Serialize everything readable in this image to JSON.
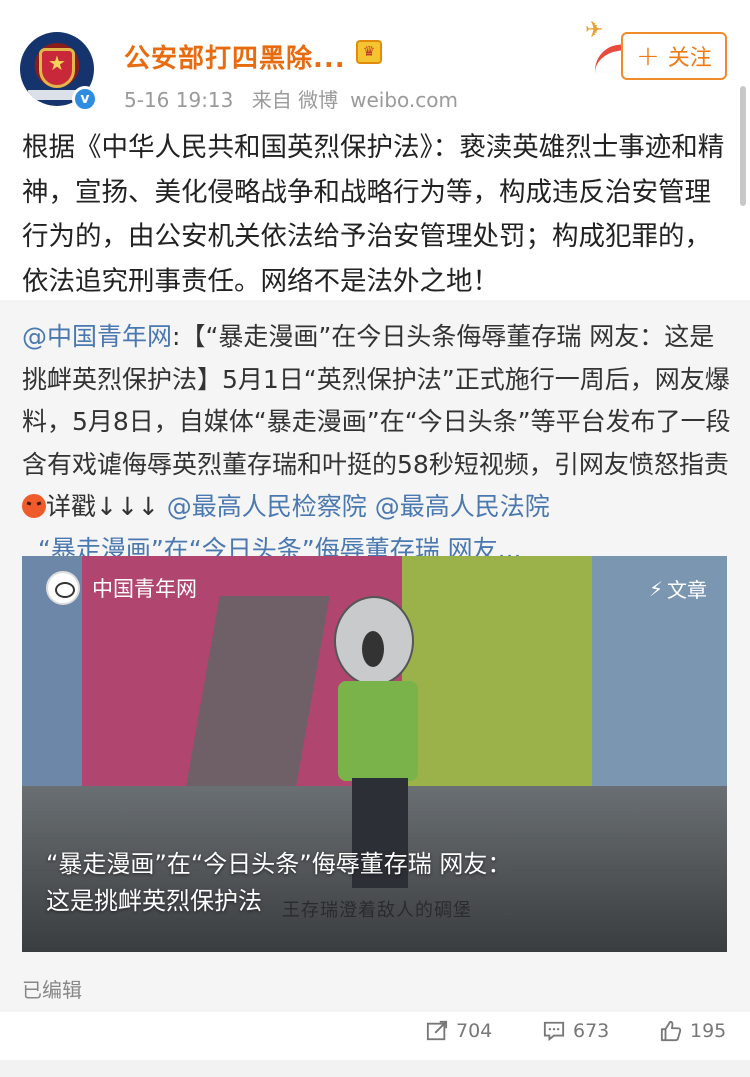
{
  "header": {
    "account_name": "公安部打四黑除...",
    "timestamp": "5-16 19:13",
    "source_prefix": "来自 微博",
    "source_site": "weibo.com",
    "follow_label": "关注",
    "follow_plus": "+"
  },
  "post": {
    "text": "根据《中华人民共和国英烈保护法》：亵渎英雄烈士事迹和精神，宣扬、美化侵略战争和战略行为等，构成违反治安管理行为的，由公安机关依法给予治安管理处罚；构成犯罪的，依法追究刑事责任。网络不是法外之地！"
  },
  "retweet": {
    "author_mention": "@中国青年网",
    "text_main": ":【“暴走漫画”在今日头条侮辱董存瑞 网友：这是挑衅英烈保护法】5月1日“英烈保护法”正式施行一周后，网友爆料，5月8日，自媒体“暴走漫画”在“今日头条”等平台发布了一段含有戏谑侮辱英烈董存瑞和叶挺的58秒短视频，引网友愤怒指责",
    "detail_text": "详戳↓↓↓",
    "mention_1": "@最高人民检察院",
    "mention_2": "@最高人民法院",
    "link_text": "“暴走漫画”在“今日头条”侮辱董存瑞 网友..."
  },
  "media": {
    "source_name": "中国青年网",
    "tag_label": "文章",
    "tag_icon": "lightning-icon",
    "caption_line1": "“暴走漫画”在“今日头条”侮辱董存瑞 网友：",
    "caption_line2": "这是挑衅英烈保护法",
    "video_subtitle": "王存瑞澄着敌人的碉堡"
  },
  "edited_label": "已编辑",
  "actions": {
    "repost_count": "704",
    "comment_count": "673",
    "like_count": "195"
  },
  "colors": {
    "name_orange": "#e86b0f",
    "link_blue": "#4a78b0",
    "follow_orange": "#f08b2a",
    "verified_blue": "#2e8de0"
  }
}
